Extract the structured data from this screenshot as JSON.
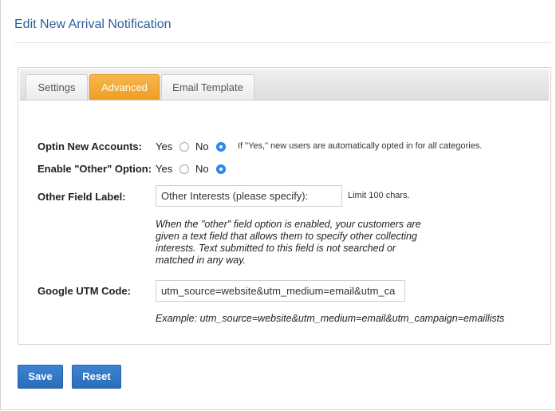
{
  "page": {
    "title": "Edit New Arrival Notification"
  },
  "tabs": [
    {
      "label": "Settings",
      "active": false
    },
    {
      "label": "Advanced",
      "active": true
    },
    {
      "label": "Email Template",
      "active": false
    }
  ],
  "optin": {
    "label": "Optin New Accounts:",
    "yes_label": "Yes",
    "no_label": "No",
    "selected": "No",
    "note": "If \"Yes,\" new users are automatically opted in for all categories."
  },
  "other_option": {
    "label": "Enable \"Other\" Option:",
    "yes_label": "Yes",
    "no_label": "No",
    "selected": "No"
  },
  "other_field": {
    "label": "Other Field Label:",
    "value": "Other Interests (please specify):",
    "limit": "Limit 100 chars.",
    "help": [
      "When the \"other\" field option is enabled, your customers are",
      "given a text field that allows them to specify other collecting",
      "interests. Text submitted to this field is not searched or",
      "matched in any way."
    ]
  },
  "utm": {
    "label": "Google UTM Code:",
    "value": "utm_source=website&utm_medium=email&utm_ca",
    "example": "Example: utm_source=website&utm_medium=email&utm_campaign=emaillists"
  },
  "actions": {
    "save_label": "Save",
    "reset_label": "Reset"
  },
  "colors": {
    "accent": "#ef9d21",
    "primary": "#2c6db9",
    "title": "#2a5f9e"
  }
}
